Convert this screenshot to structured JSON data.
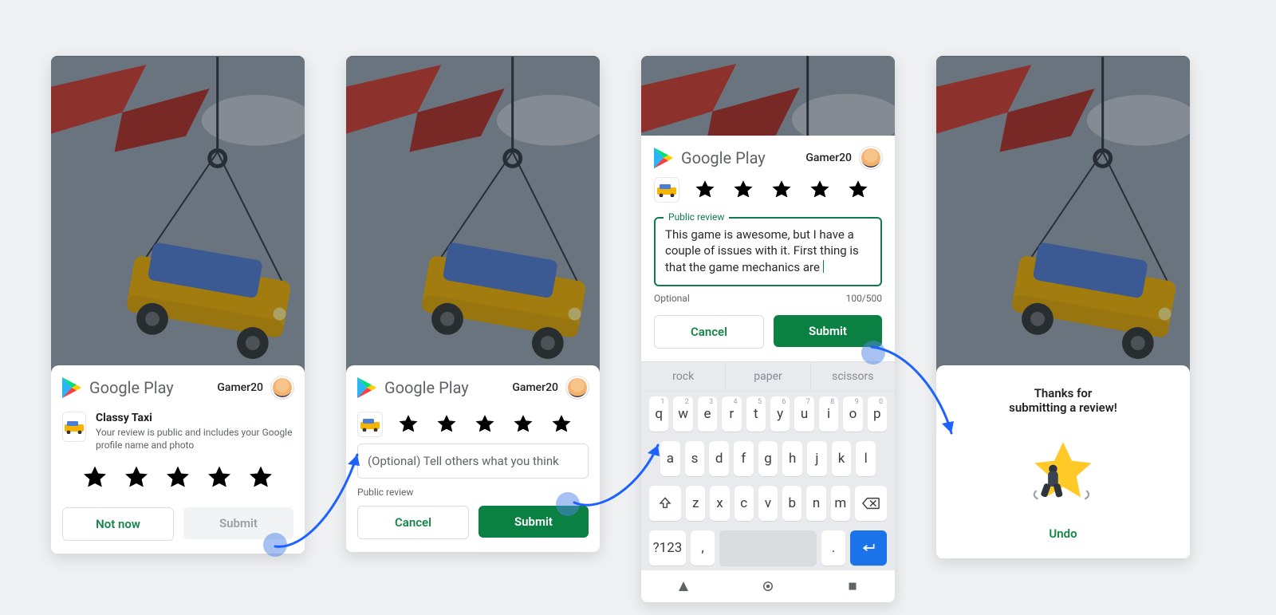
{
  "brand": {
    "wordmark": "Google Play"
  },
  "user": {
    "name": "Gamer20"
  },
  "screen1": {
    "app": {
      "name": "Classy Taxi",
      "disclaimer": "Your review is public and includes your Google profile name and photo"
    },
    "stars_selected": 0,
    "actions": {
      "not_now": "Not now",
      "submit": "Submit"
    }
  },
  "screen2": {
    "stars_selected": 4,
    "input_placeholder": "(Optional) Tell others what you think",
    "input_caption": "Public review",
    "actions": {
      "cancel": "Cancel",
      "submit": "Submit"
    }
  },
  "screen3": {
    "stars_selected": 4,
    "field_label": "Public review",
    "review_text": "This game is awesome, but I have a couple of issues with it. First thing is that the game mechanics are ",
    "helper_left": "Optional",
    "helper_right": "100/500",
    "actions": {
      "cancel": "Cancel",
      "submit": "Submit"
    },
    "keyboard": {
      "suggestions": [
        "rock",
        "paper",
        "scissors"
      ],
      "row1": [
        [
          "q",
          "1"
        ],
        [
          "w",
          "2"
        ],
        [
          "e",
          "3"
        ],
        [
          "r",
          "4"
        ],
        [
          "t",
          "5"
        ],
        [
          "y",
          "6"
        ],
        [
          "u",
          "7"
        ],
        [
          "i",
          "8"
        ],
        [
          "o",
          "9"
        ],
        [
          "p",
          "0"
        ]
      ],
      "row2": [
        "a",
        "s",
        "d",
        "f",
        "g",
        "h",
        "j",
        "k",
        "l"
      ],
      "row3": [
        "z",
        "x",
        "c",
        "v",
        "b",
        "n",
        "m"
      ],
      "sym": "?123",
      "comma": ",",
      "dot": "."
    }
  },
  "screen4": {
    "thanks_line1": "Thanks for",
    "thanks_line2": "submitting a review!",
    "undo": "Undo"
  }
}
